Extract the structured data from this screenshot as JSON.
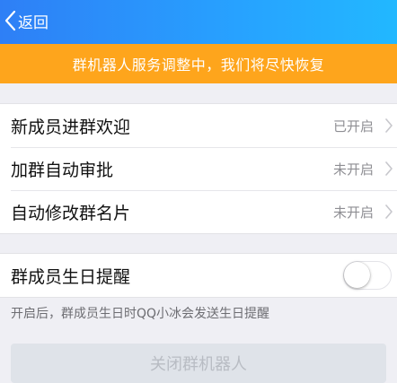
{
  "nav": {
    "back_label": "返回"
  },
  "notice": {
    "text": "群机器人服务调整中，我们将尽快恢复"
  },
  "settings": [
    {
      "label": "新成员进群欢迎",
      "status": "已开启"
    },
    {
      "label": "加群自动审批",
      "status": "未开启"
    },
    {
      "label": "自动修改群名片",
      "status": "未开启"
    }
  ],
  "birthday": {
    "label": "群成员生日提醒",
    "enabled": false,
    "hint": "开启后，群成员生日时QQ小冰会发送生日提醒"
  },
  "close_button_label": "关闭群机器人",
  "colors": {
    "header_blue": "#2e7ff6",
    "notice_orange": "#fea51c",
    "background": "#efeff4"
  },
  "icons": [
    "chevron-left-icon",
    "chevron-right-icon"
  ]
}
